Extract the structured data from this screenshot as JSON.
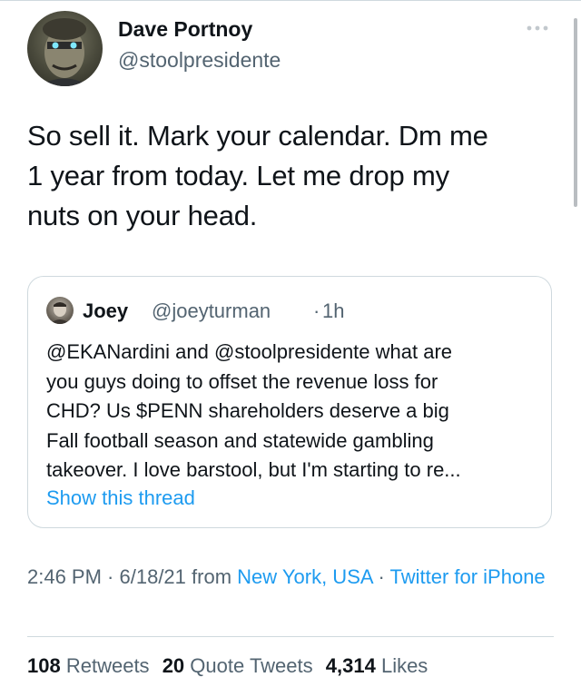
{
  "author": {
    "name": "Dave Portnoy",
    "handle": "@stoolpresidente"
  },
  "tweet": {
    "lines": [
      "So sell it.  Mark your calendar.  Dm me",
      "1 year from today.  Let me drop my",
      "nuts on your head."
    ]
  },
  "quote": {
    "name": "Joey",
    "handle": "@joeyturman",
    "separator": "·",
    "time": "1h",
    "lines": [
      "@EKANardini and @stoolpresidente what are",
      "you guys doing to offset the revenue loss for",
      "CHD? Us $PENN shareholders deserve a big",
      "Fall football season and statewide gambling",
      "takeover. I love barstool, but I'm starting to re..."
    ],
    "show_thread": "Show this thread"
  },
  "meta": {
    "time": "2:46 PM",
    "sep1": " · ",
    "date": "6/18/21",
    "from": " from ",
    "location": "New York, USA",
    "sep2": " · ",
    "source": "Twitter for iPhone"
  },
  "stats": {
    "retweets_count": "108",
    "retweets_label": "Retweets",
    "quotes_count": "20",
    "quotes_label": "Quote Tweets",
    "likes_count": "4,314",
    "likes_label": "Likes"
  },
  "colors": {
    "link": "#1d9bf0",
    "secondary_text": "#536471",
    "primary_text": "#0f1419",
    "border": "#cfd9de"
  },
  "icons": {
    "more": "more-horizontal-icon"
  }
}
